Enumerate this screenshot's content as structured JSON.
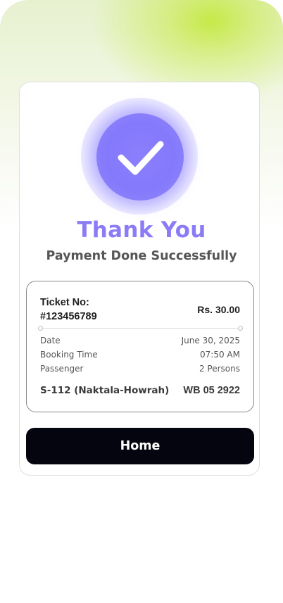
{
  "success": {
    "title": "Thank You",
    "subtitle": "Payment Done Successfully",
    "icon": "check-icon"
  },
  "ticket": {
    "label": "Ticket No:",
    "number": "#123456789",
    "price": "Rs. 30.00",
    "rows": [
      {
        "label": "Date",
        "value": "June 30, 2025"
      },
      {
        "label": "Booking Time",
        "value": "07:50 AM"
      },
      {
        "label": "Passenger",
        "value": "2 Persons"
      }
    ],
    "route": "S-112 (Naktala-Howrah)",
    "vehicle": "WB 05 2922"
  },
  "actions": {
    "home_label": "Home"
  },
  "colors": {
    "accent": "#8b7cf6",
    "button": "#05050f",
    "highlight": "#c4e940"
  }
}
